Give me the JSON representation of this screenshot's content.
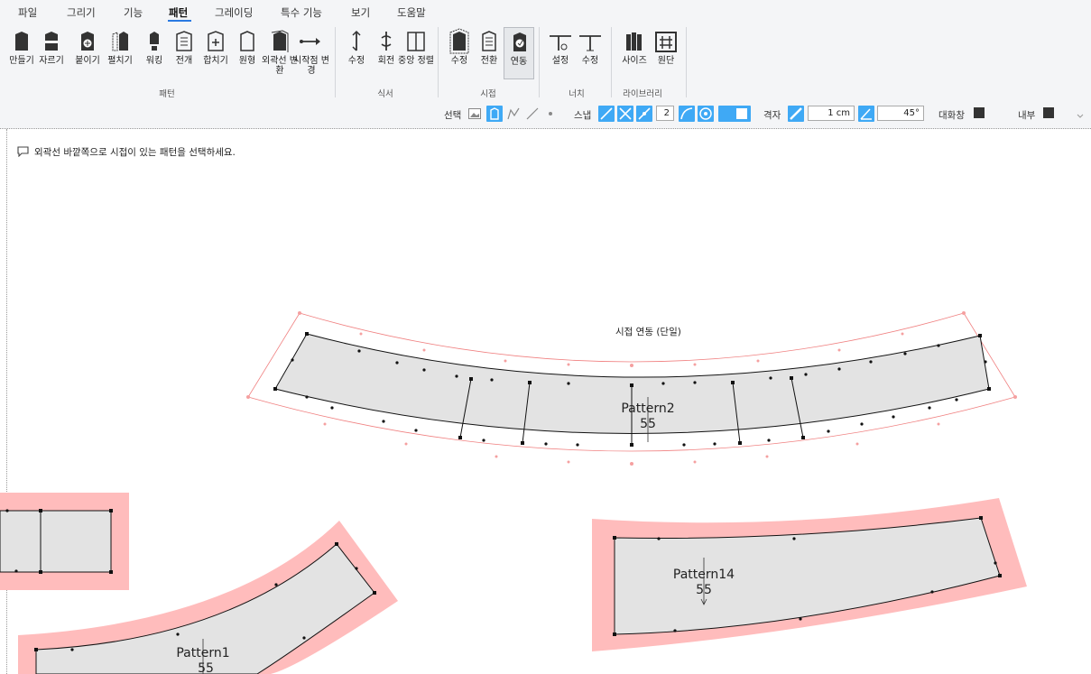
{
  "menu": {
    "items": [
      "파일",
      "그리기",
      "기능",
      "패턴",
      "그레이딩",
      "특수 기능",
      "보기",
      "도움말"
    ],
    "active": "패턴"
  },
  "ribbon": {
    "pattern_tools": [
      "만들기",
      "자르기",
      "붙이기",
      "펼치기",
      "워킹",
      "전개",
      "합치기",
      "원형",
      "외곽선 변환",
      "시작점 변경"
    ],
    "grain_tools": [
      "수정",
      "회전",
      "중앙 정렬"
    ],
    "seam_tools": [
      "수정",
      "전환",
      "연동"
    ],
    "notch_tools": [
      "설정",
      "수정"
    ],
    "library_tools": [
      "사이즈",
      "원단"
    ],
    "groups": {
      "pattern": "패턴",
      "grain": "식서",
      "seam": "시접",
      "notch": "너치",
      "library": "라이브러리"
    },
    "selected_tool": "연동"
  },
  "options": {
    "select_label": "선택",
    "snap_label": "스냅",
    "snap_count": "2",
    "grid_label": "격자",
    "grid_size": "1 cm",
    "angle": "45°",
    "dialog_label": "대화창",
    "inner_label": "내부",
    "accent": "#3fa9f5"
  },
  "canvas": {
    "hint": "외곽선 바깥쪽으로 시접이 있는 패턴을 선택하세요.",
    "seam_link_label": "시접 연동 (단일)",
    "patterns": [
      {
        "name": "Pattern2",
        "quantity": "55"
      },
      {
        "name": "Pattern14",
        "quantity": "55"
      },
      {
        "name": "Pattern1",
        "quantity": "55"
      }
    ],
    "piece_fill": "#e3e3e3",
    "seam_fill": "#ffbcbc",
    "seam_line": "#f08080"
  }
}
